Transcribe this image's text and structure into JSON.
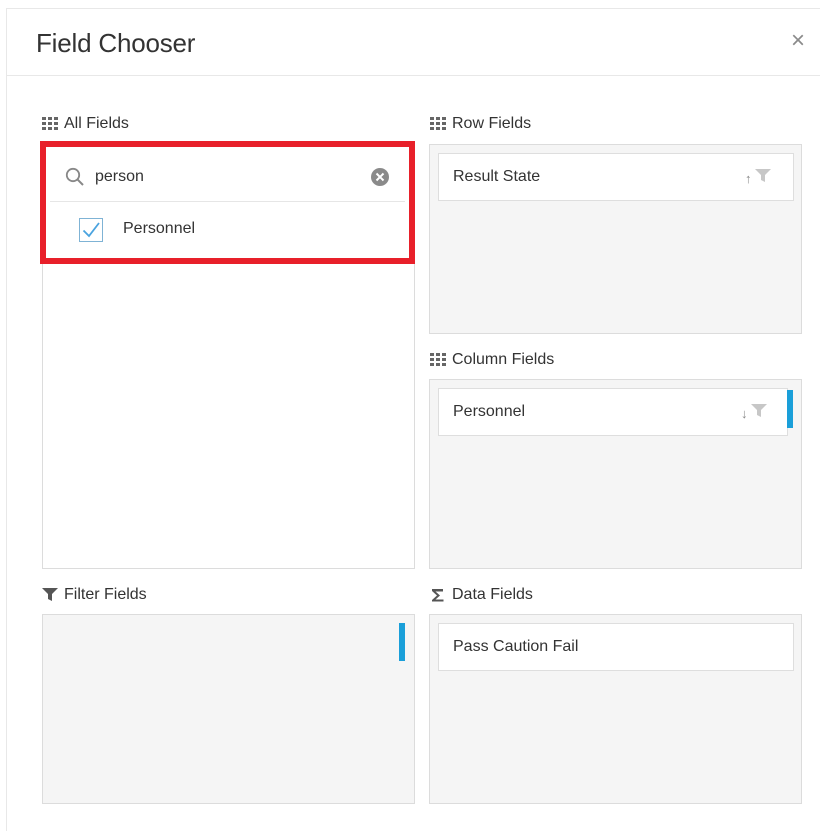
{
  "dialog": {
    "title": "Field Chooser",
    "close_icon": "×"
  },
  "all_fields": {
    "label": "All Fields",
    "icon": "grid-icon",
    "search": {
      "value": "person",
      "placeholder": ""
    },
    "items": [
      {
        "label": "Personnel",
        "checked": true
      }
    ]
  },
  "row_fields": {
    "label": "Row Fields",
    "icon": "grid-icon",
    "items": [
      {
        "label": "Result State",
        "sort": "↑"
      }
    ]
  },
  "column_fields": {
    "label": "Column Fields",
    "icon": "grid-icon",
    "items": [
      {
        "label": "Personnel",
        "sort": "↓"
      }
    ]
  },
  "filter_fields": {
    "label": "Filter Fields",
    "icon": "filter-icon",
    "items": []
  },
  "data_fields": {
    "label": "Data Fields",
    "icon": "sigma-icon",
    "items": [
      {
        "label": "Pass Caution Fail"
      }
    ]
  },
  "colors": {
    "highlight": "#e8202a",
    "accent": "#1a9fd9",
    "panel_bg": "#f5f5f5"
  }
}
